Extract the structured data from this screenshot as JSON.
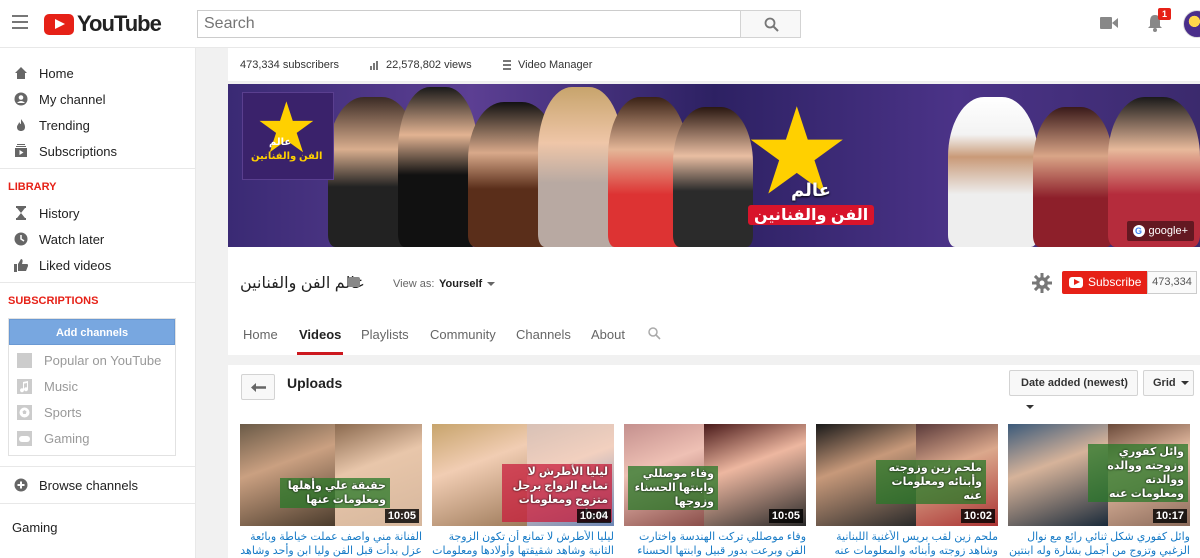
{
  "masthead": {
    "logo_text": "YouTube",
    "search_placeholder": "Search",
    "notification_count": "1"
  },
  "sidebar": {
    "nav": [
      {
        "label": "Home",
        "icon": "home-icon"
      },
      {
        "label": "My channel",
        "icon": "person-icon"
      },
      {
        "label": "Trending",
        "icon": "flame-icon"
      },
      {
        "label": "Subscriptions",
        "icon": "subscriptions-icon"
      }
    ],
    "library_heading": "LIBRARY",
    "library": [
      {
        "label": "History",
        "icon": "hourglass-icon"
      },
      {
        "label": "Watch later",
        "icon": "clock-icon"
      },
      {
        "label": "Liked videos",
        "icon": "thumbs-up-icon"
      }
    ],
    "subscriptions_heading": "SUBSCRIPTIONS",
    "add_channels_label": "Add channels",
    "suggested": [
      {
        "label": "Popular on YouTube"
      },
      {
        "label": "Music"
      },
      {
        "label": "Sports"
      },
      {
        "label": "Gaming"
      }
    ],
    "browse_channels": "Browse channels",
    "gaming": "Gaming"
  },
  "channel": {
    "subscribers": "473,334 subscribers",
    "views": "22,578,802 views",
    "video_manager": "Video Manager",
    "banner_title_top": "عالم",
    "banner_title_bottom": "الفن والفنانين",
    "logo_text_top": "عالم",
    "logo_text_bottom": "الفن والفنانين",
    "gplus_label": "google+",
    "name": "عالم الفن والفنانين",
    "view_as_label": "View as:",
    "view_as_value": "Yourself",
    "subscribe_label": "Subscribe",
    "subscriber_count": "473,334",
    "tabs": [
      "Home",
      "Videos",
      "Playlists",
      "Community",
      "Channels",
      "About"
    ],
    "active_tab": "Videos"
  },
  "uploads": {
    "title": "Uploads",
    "sort_label": "Date added (newest)",
    "view_label": "Grid",
    "videos": [
      {
        "duration": "10:05",
        "caption": "حقيقة علي وأهلها ومعلومات عنها",
        "title": "الفنانة مني واصف عملت خياطة وبائعة عزل بدأت قبل الفن وليا ابن وأحد وشاهد حقيقة"
      },
      {
        "duration": "10:04",
        "caption": "ليليا الأطرش لا تمانع الزواج برجل متزوج ومعلومات عنها",
        "title": "ليليا الأطرش لا تمانع أن تكون الزوجة الثانية وشاهد شقيقتها وأولادها ومعلومات عنها"
      },
      {
        "duration": "10:05",
        "caption": "وفاء موصللي وابنتها الحسناء وزوجها",
        "title": "وفاء موصللي تركت الهندسة واختارت الفن وبرعت بدور قبيل وابنتها الحسناء ومن"
      },
      {
        "duration": "10:02",
        "caption": "ملحم زين وزوجته وأبنائه ومعلومات عنه",
        "title": "ملحم زين لقب بريس الأغنية اللبنانية وشاهد زوجته وأبنائه والمعلومات عنه"
      },
      {
        "duration": "10:17",
        "caption": "وائل كفوري وزوجته ووالده ووالدته ومعلومات عنه",
        "title": "وائل كفوري شكل ثنائي رائع مع نوال الزغبي وتزوج من أجمل بشارة وله ابنتين وشاهد"
      }
    ]
  }
}
